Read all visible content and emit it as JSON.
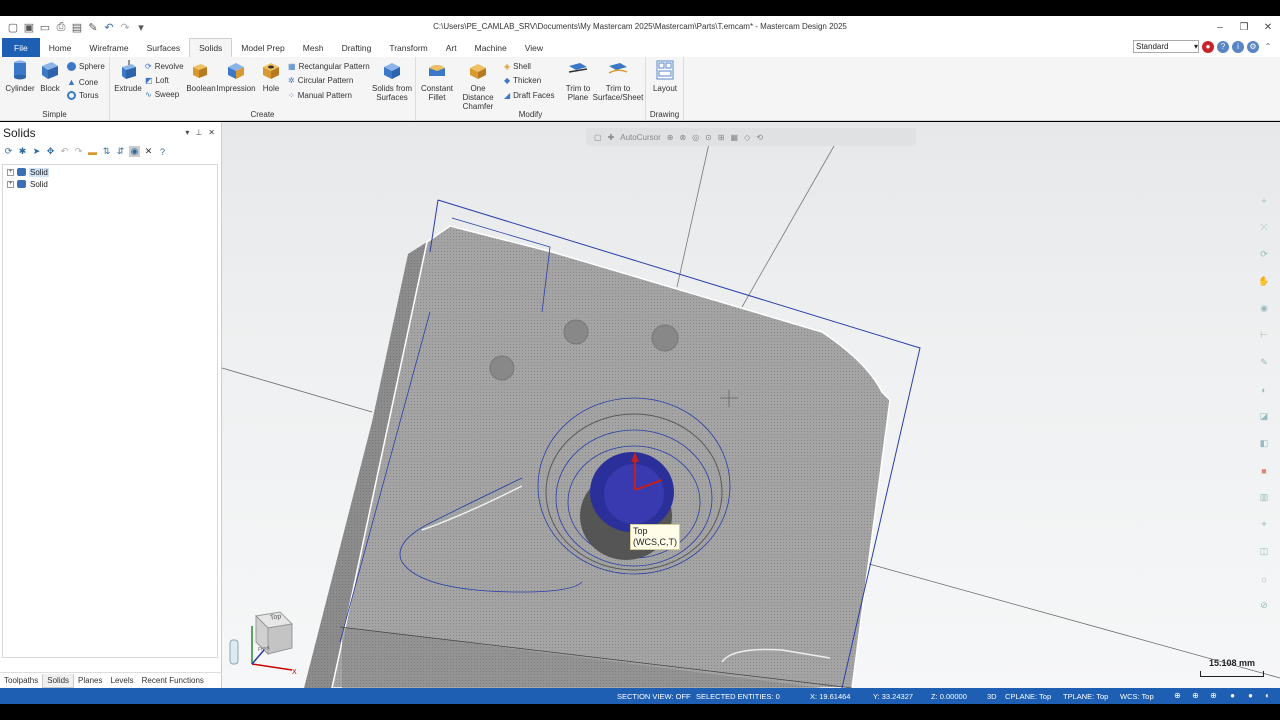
{
  "window": {
    "title": "C:\\Users\\PE_CAMLAB_SRV\\Documents\\My Mastercam 2025\\Mastercam\\Parts\\T.emcam* - Mastercam Design 2025"
  },
  "ribbon": {
    "tabs": [
      "File",
      "Home",
      "Wireframe",
      "Surfaces",
      "Solids",
      "Model Prep",
      "Mesh",
      "Drafting",
      "Transform",
      "Art",
      "Machine",
      "View"
    ],
    "active_tab": "Solids",
    "workspace": "Standard",
    "groups": {
      "simple": {
        "label": "Simple",
        "cylinder": "Cylinder",
        "block": "Block",
        "sphere": "Sphere",
        "cone": "Cone",
        "torus": "Torus"
      },
      "create": {
        "label": "Create",
        "extrude": "Extrude",
        "revolve": "Revolve",
        "loft": "Loft",
        "sweep": "Sweep",
        "boolean": "Boolean",
        "impression": "Impression",
        "hole": "Hole",
        "rect_pattern": "Rectangular Pattern",
        "circ_pattern": "Circular Pattern",
        "manual_pattern": "Manual Pattern",
        "solids_from_surfaces_1": "Solids from",
        "solids_from_surfaces_2": "Surfaces"
      },
      "modify": {
        "label": "Modify",
        "constant_fillet_1": "Constant",
        "constant_fillet_2": "Fillet",
        "one_distance_1": "One Distance",
        "one_distance_2": "Chamfer",
        "shell": "Shell",
        "thicken": "Thicken",
        "draft_faces": "Draft Faces",
        "trim_plane_1": "Trim to",
        "trim_plane_2": "Plane",
        "trim_surface_1": "Trim to",
        "trim_surface_2": "Surface/Sheet"
      },
      "drawing": {
        "label": "Drawing",
        "layout": "Layout"
      }
    }
  },
  "solids_panel": {
    "title": "Solids",
    "items": [
      "Solid",
      "Solid"
    ],
    "bottom_tabs": [
      "Toolpaths",
      "Solids",
      "Planes",
      "Levels",
      "Recent Functions"
    ],
    "active_bottom_tab": "Solids"
  },
  "viewport": {
    "autocursor": "AutoCursor",
    "tooltip_line1": "Top",
    "tooltip_line2": "(WCS,C,T)",
    "scale": "15.108 mm",
    "viewcube_top": "Top",
    "viewcube_front": "Front"
  },
  "status": {
    "section_view": "SECTION VIEW: OFF",
    "selected": "SELECTED ENTITIES: 0",
    "x": "X:   19.61464",
    "y": "Y:   33.24327",
    "z": "Z:   0.00000",
    "mode": "3D",
    "cplane": "CPLANE: Top",
    "tplane": "TPLANE: Top",
    "wcs": "WCS: Top"
  },
  "colors": {
    "accent": "#1e5fb4",
    "part_fill": "#9c9c9c",
    "wire_blue": "#2a3ea8"
  }
}
